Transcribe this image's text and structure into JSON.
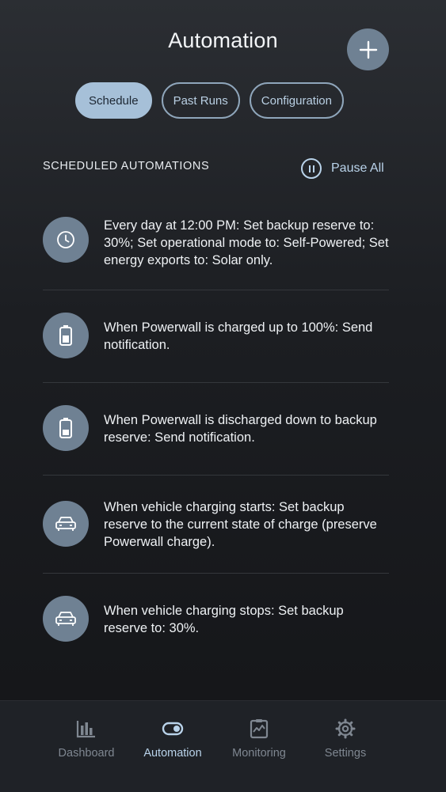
{
  "header": {
    "title": "Automation"
  },
  "tabs": [
    {
      "label": "Schedule",
      "active": true
    },
    {
      "label": "Past Runs",
      "active": false
    },
    {
      "label": "Configuration",
      "active": false
    }
  ],
  "section": {
    "label": "SCHEDULED AUTOMATIONS",
    "pause_label": "Pause All"
  },
  "automations": [
    {
      "icon": "clock-icon",
      "text": "Every day at 12:00 PM: Set backup reserve to: 30%; Set operational mode to: Self-Powered; Set energy exports to: Solar only."
    },
    {
      "icon": "battery-full-icon",
      "text": "When Powerwall is charged up to 100%: Send notification."
    },
    {
      "icon": "battery-low-icon",
      "text": "When Powerwall is discharged down to backup reserve: Send notification."
    },
    {
      "icon": "car-icon",
      "text": "When vehicle charging starts: Set backup reserve to the current state of charge (preserve Powerwall charge)."
    },
    {
      "icon": "car-icon",
      "text": "When vehicle charging stops: Set backup reserve to: 30%."
    }
  ],
  "nav": [
    {
      "label": "Dashboard",
      "icon": "bar-chart-icon",
      "active": false
    },
    {
      "label": "Automation",
      "icon": "toggle-icon",
      "active": true
    },
    {
      "label": "Monitoring",
      "icon": "monitor-chart-icon",
      "active": false
    },
    {
      "label": "Settings",
      "icon": "gear-icon",
      "active": false
    }
  ],
  "colors": {
    "accent": "#a6c0d8",
    "icon_bg": "#6f8193",
    "nav_inactive": "#7f8791"
  }
}
